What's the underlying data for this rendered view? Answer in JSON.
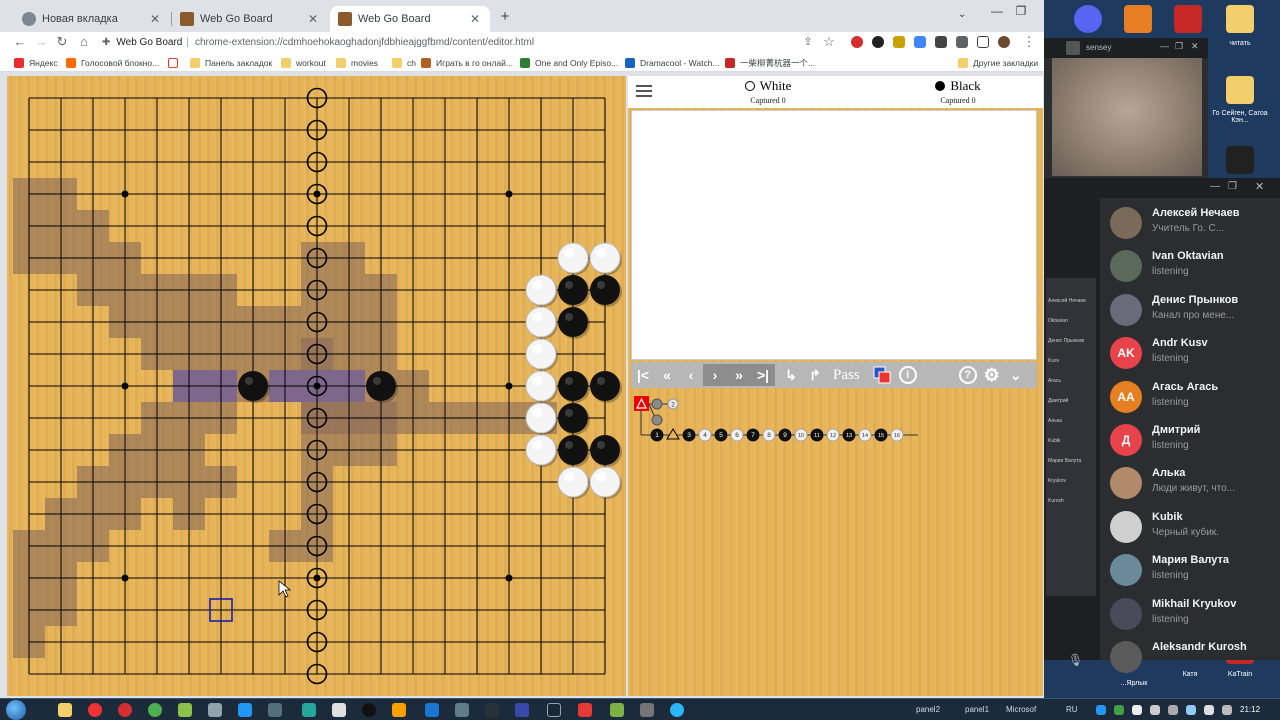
{
  "browser": {
    "tabs": [
      {
        "title": "Новая вкладка",
        "color": "#5f6368",
        "active": false
      },
      {
        "title": "Web Go Board",
        "color": "#8b5a2b",
        "active": false
      },
      {
        "title": "Web Go Board",
        "color": "#8b5a2b",
        "active": true
      }
    ],
    "new_tab_icon": "plus-icon",
    "site_name": "Web Go Board",
    "url": "chrome-extension://cdmhoehokaoghadonjfdbhieajggfbmd/content/editor.html",
    "bookmarks": [
      {
        "label": "Яндекс",
        "color": "#e62e2e"
      },
      {
        "label": "Голосовой блокно...",
        "color": "#ff6a00"
      },
      {
        "label": "",
        "color": "#ffffff"
      },
      {
        "label": "Панель закладок",
        "color": "#f2cf6b"
      },
      {
        "label": "workout",
        "color": "#f2cf6b"
      },
      {
        "label": "movies",
        "color": "#f2cf6b"
      },
      {
        "label": "ch",
        "color": "#f2cf6b"
      },
      {
        "label": "Играть в го онлай...",
        "color": "#b06020"
      },
      {
        "label": "One and Only Episo...",
        "color": "#2e7d32"
      },
      {
        "label": "Dramacool - Watch...",
        "color": "#1565c0"
      },
      {
        "label": "一柴柳菁杭器一个...",
        "color": "#c62828"
      },
      {
        "label": "Другие закладки",
        "color": "#f2cf6b"
      }
    ]
  },
  "board": {
    "size": 19,
    "accent_blue": "#1f1fa8",
    "territory_color": "#8a6a58",
    "territory_light": "#a88a78",
    "stones": [
      {
        "col": 7,
        "row": 9,
        "color": "black"
      },
      {
        "col": 11,
        "row": 9,
        "color": "black"
      },
      {
        "col": 17,
        "row": 6,
        "color": "black"
      },
      {
        "col": 18,
        "row": 6,
        "color": "black"
      },
      {
        "col": 17,
        "row": 7,
        "color": "black"
      },
      {
        "col": 17,
        "row": 9,
        "color": "black"
      },
      {
        "col": 18,
        "row": 9,
        "color": "black"
      },
      {
        "col": 17,
        "row": 10,
        "color": "black"
      },
      {
        "col": 17,
        "row": 11,
        "color": "black"
      },
      {
        "col": 18,
        "row": 11,
        "color": "black"
      },
      {
        "col": 17,
        "row": 5,
        "color": "white"
      },
      {
        "col": 18,
        "row": 5,
        "color": "white"
      },
      {
        "col": 16,
        "row": 6,
        "color": "white"
      },
      {
        "col": 16,
        "row": 7,
        "color": "white"
      },
      {
        "col": 16,
        "row": 8,
        "color": "white"
      },
      {
        "col": 16,
        "row": 9,
        "color": "white"
      },
      {
        "col": 16,
        "row": 10,
        "color": "white"
      },
      {
        "col": 16,
        "row": 11,
        "color": "white"
      },
      {
        "col": 17,
        "row": 12,
        "color": "white"
      },
      {
        "col": 18,
        "row": 12,
        "color": "white"
      }
    ],
    "circle_marks_col": 9,
    "square_mark": {
      "col": 6,
      "row": 16
    }
  },
  "players": {
    "white": {
      "name": "White",
      "captured": "Captured 0"
    },
    "black": {
      "name": "Black",
      "captured": "Captured 0"
    }
  },
  "nav": {
    "first_icon": "first-move-icon",
    "back10_icon": "back-ten-icon",
    "back_icon": "back-icon",
    "forward_icon": "forward-icon",
    "forward10_icon": "forward-ten-icon",
    "last_icon": "last-move-icon",
    "pass_label": "Pass"
  },
  "tree": {
    "moves": [
      "1",
      "",
      "3",
      "4",
      "5",
      "6",
      "7",
      "8",
      "9",
      "10",
      "11",
      "12",
      "13",
      "14",
      "15",
      "16"
    ],
    "branch_label": "2"
  },
  "discord": {
    "top_channel": "sensey",
    "users": [
      {
        "name": "Алексей Нечаев",
        "status": "Учитель Го. С...",
        "initials": "",
        "color": "#7a6a5a"
      },
      {
        "name": "Ivan Oktavian",
        "status": "listening",
        "initials": "",
        "color": "#5a6a5a"
      },
      {
        "name": "Денис Прынков",
        "status": "Канал про мене...",
        "initials": "",
        "color": "#6a6a7a"
      },
      {
        "name": "Andr Kusv",
        "status": "listening",
        "initials": "AK",
        "color": "#e8434b"
      },
      {
        "name": "Агась Агась",
        "status": "listening",
        "initials": "AA",
        "color": "#e67e22"
      },
      {
        "name": "Дмитрий",
        "status": "listening",
        "initials": "Д",
        "color": "#e8434b"
      },
      {
        "name": "Алька",
        "status": "Люди живут, что...",
        "initials": "",
        "color": "#b08a6a"
      },
      {
        "name": "Kubik",
        "status": "Черный кубик.",
        "initials": "",
        "color": "#cfcfcf"
      },
      {
        "name": "Мария Валута",
        "status": "listening",
        "initials": "",
        "color": "#6a8a9a"
      },
      {
        "name": "Mikhail Kryukov",
        "status": "listening",
        "initials": "",
        "color": "#4a4a5a"
      },
      {
        "name": "Aleksandr Kurosh",
        "status": "",
        "initials": "",
        "color": "#5a5a5a"
      }
    ],
    "mini_list": [
      "Алексей Нечаев",
      "Oktavian",
      "Денис Прынков",
      "Kusv",
      "Агась",
      "Дмитрий",
      "Алька",
      "Kubik",
      "Мария Валута",
      "Kryukov",
      "Kurosh"
    ]
  },
  "desktop": {
    "icon_top_label": "читать",
    "label_go": "Го Сейген, Сагоа Кэн...",
    "label_bottom1": "...Ярлык",
    "label_bottom2": "Катя",
    "label_bottom3": "KaTrain"
  },
  "taskbar": {
    "panel2": "panel2",
    "panel1": "panel1",
    "microsoft": "Microsof",
    "lang": "RU",
    "clock": "21:12"
  }
}
